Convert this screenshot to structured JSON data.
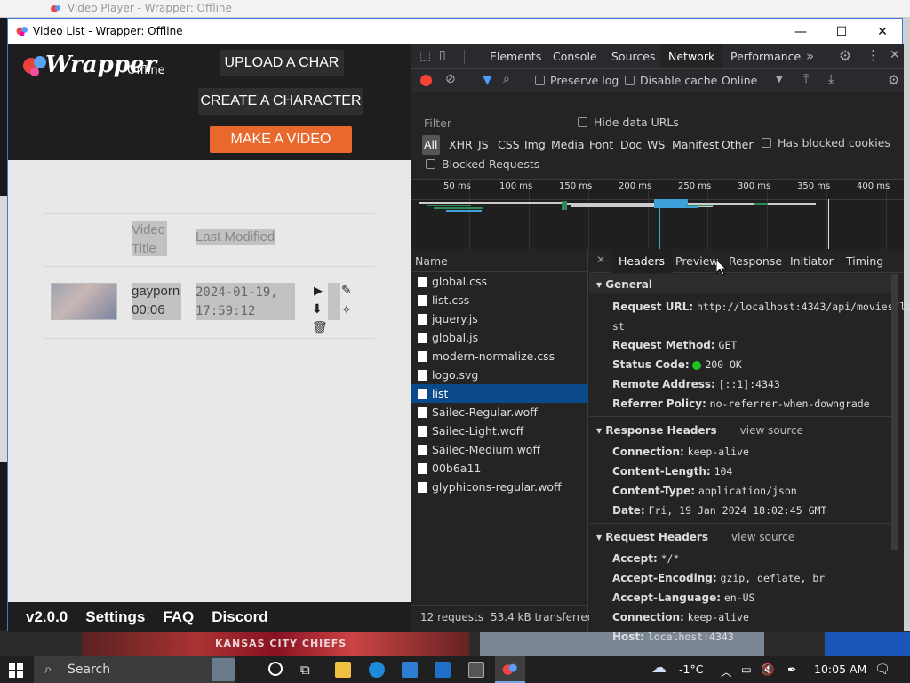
{
  "background_window": {
    "title": "Video Player - Wrapper: Offline"
  },
  "window": {
    "title": "Video List - Wrapper: Offline",
    "controls": {
      "minimize": "—",
      "maximize": "☐",
      "close": "✕"
    }
  },
  "app": {
    "logo": {
      "main": "Wrapper",
      "sub": "Offline"
    },
    "buttons": {
      "upload": "UPLOAD A CHAR",
      "create": "CREATE A CHARACTER",
      "make": "MAKE A VIDEO"
    },
    "table": {
      "headers": [
        "Video Title",
        "Last Modified"
      ],
      "rows": [
        {
          "title": "gayporn",
          "duration": "00:06",
          "modified": "2024-01-19, 17:59:12"
        }
      ]
    },
    "footer": [
      "v2.0.0",
      "Settings",
      "FAQ",
      "Discord"
    ]
  },
  "devtools": {
    "tabs": [
      "Elements",
      "Console",
      "Sources",
      "Network",
      "Performance"
    ],
    "selected_tab": "Network",
    "toolbar": {
      "preserve_log": "Preserve log",
      "disable_cache": "Disable cache",
      "throttle": "Online"
    },
    "filter": {
      "placeholder": "Filter",
      "hide_data_urls": "Hide data URLs",
      "blocked_requests": "Blocked Requests",
      "has_blocked_cookies": "Has blocked cookies",
      "types": [
        "All",
        "XHR",
        "JS",
        "CSS",
        "Img",
        "Media",
        "Font",
        "Doc",
        "WS",
        "Manifest",
        "Other"
      ]
    },
    "timeline": {
      "ticks": [
        "50 ms",
        "100 ms",
        "150 ms",
        "200 ms",
        "250 ms",
        "300 ms",
        "350 ms",
        "400 ms"
      ]
    },
    "requests": {
      "header": "Name",
      "selected": "list",
      "items": [
        "global.css",
        "list.css",
        "jquery.js",
        "global.js",
        "modern-normalize.css",
        "logo.svg",
        "list",
        "Sailec-Regular.woff",
        "Sailec-Light.woff",
        "Sailec-Medium.woff",
        "00b6a11",
        "glyphicons-regular.woff"
      ],
      "summary": {
        "count": "12 requests",
        "transferred": "53.4 kB transferred"
      }
    },
    "detail": {
      "tabs": [
        "Headers",
        "Preview",
        "Response",
        "Initiator",
        "Timing"
      ],
      "general": {
        "title": "General",
        "request_url_label": "Request URL:",
        "request_url_1": "http://localhost:4343/api/movies/li",
        "request_url_2": "st",
        "method_label": "Request Method:",
        "method": "GET",
        "status_label": "Status Code:",
        "status": "200 OK",
        "remote_label": "Remote Address:",
        "remote": "[::1]:4343",
        "referrer_label": "Referrer Policy:",
        "referrer": "no-referrer-when-downgrade"
      },
      "response_headers": {
        "title": "Response Headers",
        "view_source": "view source",
        "items": [
          [
            "Connection:",
            "keep-alive"
          ],
          [
            "Content-Length:",
            "104"
          ],
          [
            "Content-Type:",
            "application/json"
          ],
          [
            "Date:",
            "Fri, 19 Jan 2024 18:02:45 GMT"
          ]
        ]
      },
      "request_headers": {
        "title": "Request Headers",
        "view_source": "view source",
        "items": [
          [
            "Accept:",
            "*/*"
          ],
          [
            "Accept-Encoding:",
            "gzip, deflate, br"
          ],
          [
            "Accept-Language:",
            "en-US"
          ],
          [
            "Connection:",
            "keep-alive"
          ],
          [
            "Host:",
            "localhost:4343"
          ]
        ]
      }
    }
  },
  "taskbar": {
    "search": "Search",
    "temperature": "-1°C",
    "time": "10:05 AM"
  },
  "colors": {
    "accent_orange": "#e8682d",
    "devtools_bg": "#242424",
    "selected_row": "#0a4a8a",
    "status_green": "#1fc21f"
  }
}
